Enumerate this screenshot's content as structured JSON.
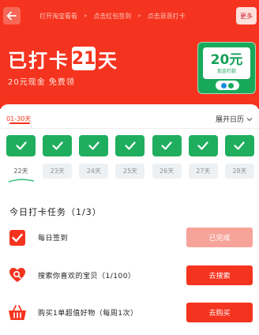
{
  "header": {
    "ticker": [
      "打开淘宝看看",
      "点击红包签到",
      "点击逛逛打卡"
    ],
    "more_label": "更多",
    "streak_prefix": "已打卡",
    "streak_days": "21",
    "streak_suffix": "天",
    "subtitle": "20元现金 免费领"
  },
  "cash_card": {
    "amount": "20元",
    "label": "现金打款"
  },
  "calendar": {
    "range_label": "01-30天",
    "expand_label": "展开日历",
    "days": [
      "22天",
      "23天",
      "24天",
      "25天",
      "26天",
      "27天",
      "28天"
    ],
    "today_index": 0
  },
  "tasks": {
    "title": "今日打卡任务（1/3）",
    "items": [
      {
        "icon": "checkbox-icon",
        "text": "每日签到",
        "button": "已完成",
        "done": true
      },
      {
        "icon": "heart-search-icon",
        "text": "搜索你喜欢的宝贝（1/100）",
        "button": "去搜索",
        "done": false
      },
      {
        "icon": "basket-icon",
        "text": "购买1单超值好物（每周1次）",
        "button": "去购买",
        "done": false
      }
    ]
  },
  "colors": {
    "brand_red": "#f5341f",
    "check_green": "#1fae5e",
    "done_button": "#f6a39a"
  }
}
